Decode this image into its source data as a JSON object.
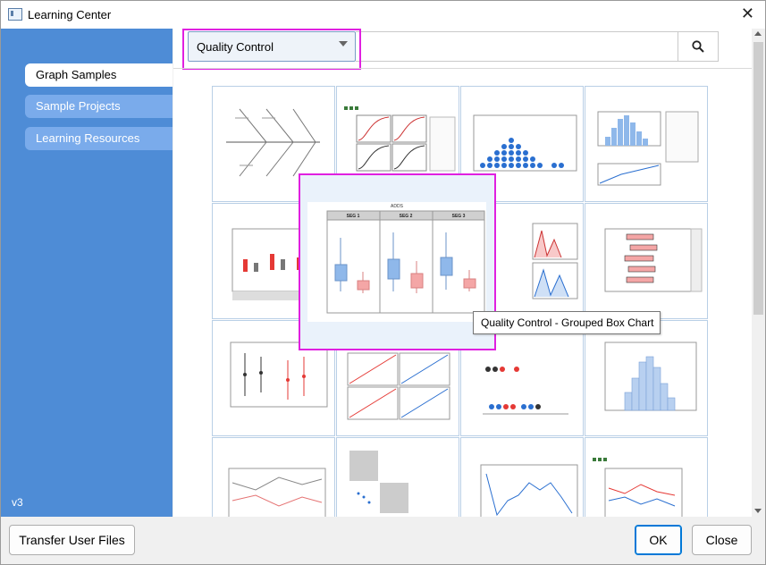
{
  "window": {
    "title": "Learning Center",
    "close_label": "✕"
  },
  "sidebar": {
    "items": [
      {
        "label": "Graph Samples",
        "active": true
      },
      {
        "label": "Sample Projects",
        "active": false
      },
      {
        "label": "Learning Resources",
        "active": false
      }
    ],
    "version": "v3"
  },
  "filter": {
    "selected": "Quality Control",
    "search_value": ""
  },
  "popup": {
    "title": "Quality Control - Grouped Box Chart",
    "preview_heading": "ADDS",
    "segments": [
      "SEG 1",
      "SEG 2",
      "SEG 3"
    ]
  },
  "footer": {
    "transfer_label": "Transfer User Files",
    "ok_label": "OK",
    "close_label": "Close"
  },
  "colors": {
    "sidebar": "#4e8cd6",
    "highlight": "#e020e0",
    "box_blue": "#8fb8ea",
    "box_red": "#f4a6a6"
  }
}
